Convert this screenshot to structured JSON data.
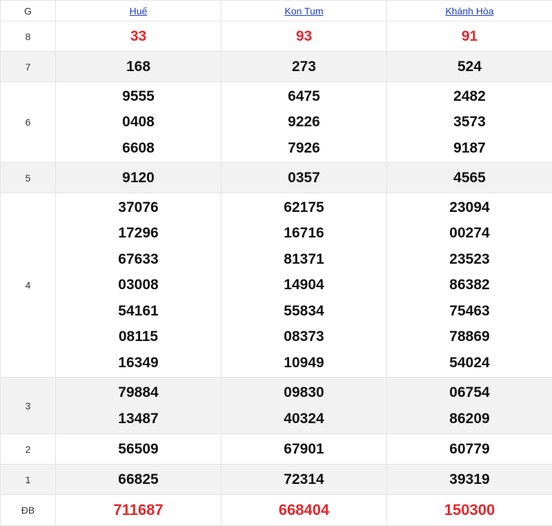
{
  "header": {
    "g_label": "G",
    "provinces": [
      "Huế",
      "Kon Tum",
      "Khánh Hòa"
    ]
  },
  "rows": [
    {
      "label": "8",
      "cols": [
        [
          "33"
        ],
        [
          "93"
        ],
        [
          "91"
        ]
      ]
    },
    {
      "label": "7",
      "cols": [
        [
          "168"
        ],
        [
          "273"
        ],
        [
          "524"
        ]
      ]
    },
    {
      "label": "6",
      "cols": [
        [
          "9555",
          "0408",
          "6608"
        ],
        [
          "6475",
          "9226",
          "7926"
        ],
        [
          "2482",
          "3573",
          "9187"
        ]
      ]
    },
    {
      "label": "5",
      "cols": [
        [
          "9120"
        ],
        [
          "0357"
        ],
        [
          "4565"
        ]
      ]
    },
    {
      "label": "4",
      "cols": [
        [
          "37076",
          "17296",
          "67633",
          "03008",
          "54161",
          "08115",
          "16349"
        ],
        [
          "62175",
          "16716",
          "81371",
          "14904",
          "55834",
          "08373",
          "10949"
        ],
        [
          "23094",
          "00274",
          "23523",
          "86382",
          "75463",
          "78869",
          "54024"
        ]
      ]
    },
    {
      "label": "3",
      "cols": [
        [
          "79884",
          "13487"
        ],
        [
          "09830",
          "40324"
        ],
        [
          "06754",
          "86209"
        ]
      ]
    },
    {
      "label": "2",
      "cols": [
        [
          "56509"
        ],
        [
          "67901"
        ],
        [
          "60779"
        ]
      ]
    },
    {
      "label": "1",
      "cols": [
        [
          "66825"
        ],
        [
          "72314"
        ],
        [
          "39319"
        ]
      ]
    },
    {
      "label": "ĐB",
      "cols": [
        [
          "711687"
        ],
        [
          "668404"
        ],
        [
          "150300"
        ]
      ]
    }
  ],
  "colors": {
    "special_red": "#e8262b",
    "link_blue": "#1a3bc4",
    "alt_row": "#f2f2f2"
  }
}
